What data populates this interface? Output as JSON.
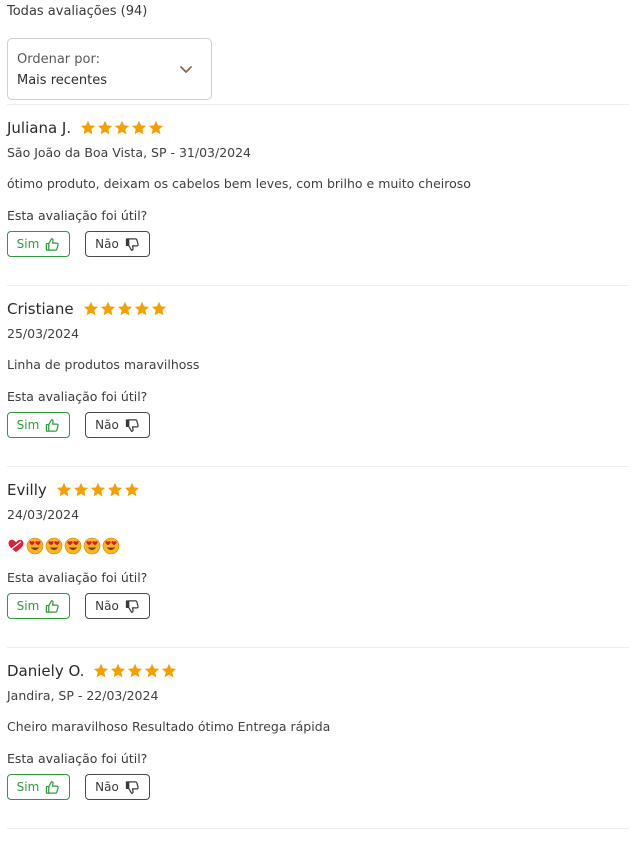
{
  "header": {
    "all_reviews": "Todas avaliações (94)"
  },
  "sort": {
    "label": "Ordenar por:",
    "value": "Mais recentes"
  },
  "colors": {
    "star": "#f5a000",
    "accent_green": "#2e9a3a"
  },
  "reviews": [
    {
      "name": "Juliana J.",
      "rating": 5,
      "meta": "São João da Boa Vista, SP - 31/03/2024",
      "text": "ótimo produto, deixam os cabelos bem leves, com brilho e muito cheiroso",
      "question": "Esta avaliação foi útil?",
      "yes": "Sim",
      "no": "Não"
    },
    {
      "name": "Cristiane",
      "rating": 5,
      "meta": "25/03/2024",
      "text": "Linha de produtos maravilhoss",
      "question": "Esta avaliação foi útil?",
      "yes": "Sim",
      "no": "Não"
    },
    {
      "name": "Evilly",
      "rating": 5,
      "meta": "24/03/2024",
      "text_emojis": [
        "heart-exclamation-icon",
        "heart-eyes-face-icon",
        "heart-eyes-face-icon",
        "heart-eyes-face-icon",
        "heart-eyes-face-icon",
        "heart-eyes-face-icon"
      ],
      "question": "Esta avaliação foi útil?",
      "yes": "Sim",
      "no": "Não"
    },
    {
      "name": "Daniely O.",
      "rating": 5,
      "meta": "Jandira, SP - 22/03/2024",
      "text": "Cheiro maravilhoso Resultado ótimo Entrega rápida",
      "question": "Esta avaliação foi útil?",
      "yes": "Sim",
      "no": "Não"
    }
  ]
}
